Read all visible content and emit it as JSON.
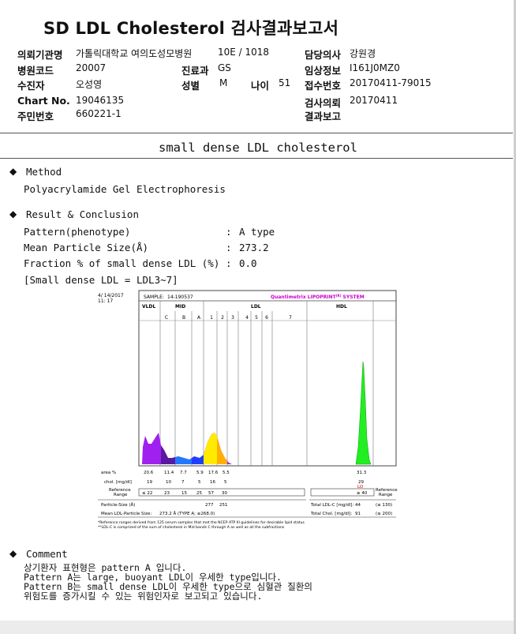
{
  "report": {
    "title": "SD LDL Cholesterol 검사결과보고서",
    "fields": {
      "institution_label": "의뢰기관명",
      "institution_value": "가톨릭대학교 여의도성모병원",
      "ward_value": "10E / 1018",
      "doctor_label": "담당의사",
      "doctor_value": "강원경",
      "hospital_code_label": "병원코드",
      "hospital_code_value": "20007",
      "department_label": "진료과",
      "department_value": "GS",
      "clinical_info_label": "임상정보",
      "clinical_info_value": "I161J0MZ0",
      "patient_label": "수진자",
      "patient_value": "오성영",
      "sex_label": "성별",
      "sex_value": "M",
      "age_label": "나이",
      "age_value": "51",
      "receipt_label": "접수번호",
      "receipt_value": "20170411-79015",
      "chart_label": "Chart No.",
      "chart_value": "19046135",
      "request_date_label": "검사의뢰",
      "request_date_value": "20170411",
      "id_label": "주민번호",
      "id_value": "660221-1",
      "result_report_label": "결과보고",
      "result_report_value": ""
    },
    "section_title": "small dense LDL cholesterol",
    "method_heading": "Method",
    "method_text": "Polyacrylamide Gel Electrophoresis",
    "result_heading": "Result & Conclusion",
    "results": [
      {
        "label": "Pattern(phenotype)",
        "sep": ":",
        "value": "A type"
      },
      {
        "label": "Mean Particle Size(Å)",
        "sep": ":",
        "value": "273.2"
      },
      {
        "label": "Fraction % of small dense LDL (%)",
        "sep": ":",
        "value": "0.0"
      }
    ],
    "ldl_note": "[Small dense LDL = LDL3~7]",
    "comment_heading": "Comment",
    "comment_lines": [
      "상기환자 표현형은 pattern A 입니다.",
      "Pattern A는 large, buoyant LDL이 우세한 type입니다.",
      "Pattern B는 small dense LDL이 우세한 type으로 심혈관 질환의",
      "위험도를 증가시킬 수 있는 위험인자로 보고되고 있습니다."
    ]
  },
  "lipoprint": {
    "date": "4/ 14/2017",
    "time": "11: 17",
    "sample_label": "SAMPLE:",
    "sample_value": "14-190537",
    "brand": "Quantimetrix LIPOPRINT",
    "brand_sup": "(R)",
    "brand_tail": " SYSTEM",
    "band_groups": [
      "VLDL",
      "MID",
      "LDL",
      "HDL"
    ],
    "bands": [
      "C",
      "B",
      "A",
      "1",
      "2",
      "3",
      "4",
      "5",
      "6",
      "7"
    ],
    "area_label": "area %",
    "area_values": [
      "20.6",
      "11.4",
      "7.7",
      "5.9",
      "17.6",
      "5.5",
      "31.3"
    ],
    "chol_label": "chol. [mg/dl]",
    "chol_values": [
      "19",
      "10",
      "7",
      "5",
      "16",
      "5",
      "29"
    ],
    "hdl_flag": "LO",
    "ref_label_line1": "Reference",
    "ref_label_line2": "Range",
    "ref_values": [
      "≤ 22",
      "23",
      "15",
      "25",
      "57",
      "30"
    ],
    "ref_hdl": "≥ 40",
    "particle_label": "Particle-Size (Å)",
    "particle_values": [
      "277",
      "251"
    ],
    "mean_label": "Mean LDL-Particle Size:",
    "mean_value": "273.2 Å   (TYPE A; ≥268.0)",
    "total_ldl_label": "Total LDL-C [mg/dl]:",
    "total_ldl_value": "44",
    "total_ldl_ref": "(≤ 130)",
    "total_chol_label": "Total Chol. [mg/dl]:",
    "total_chol_value": "91",
    "total_chol_ref": "(≤ 200)",
    "footnote1": "*Reference ranges derived from 125 serum samples that met the NCEP ATP III guidelines for desirable lipid status",
    "footnote2": "**LDL-C is comprized of the sum of cholesterol in Mid bands C through A as well as all the subfractions",
    "colors": {
      "vldl": "#a020f0",
      "mid_c": "#6a1fb0",
      "mid_b": "#1f78ff",
      "mid_a": "#1f3fff",
      "ldl1": "#ffea00",
      "ldl2": "#ffb000",
      "hdl": "#22ee22",
      "brand": "#cc00cc",
      "flag": "#d00000"
    }
  }
}
